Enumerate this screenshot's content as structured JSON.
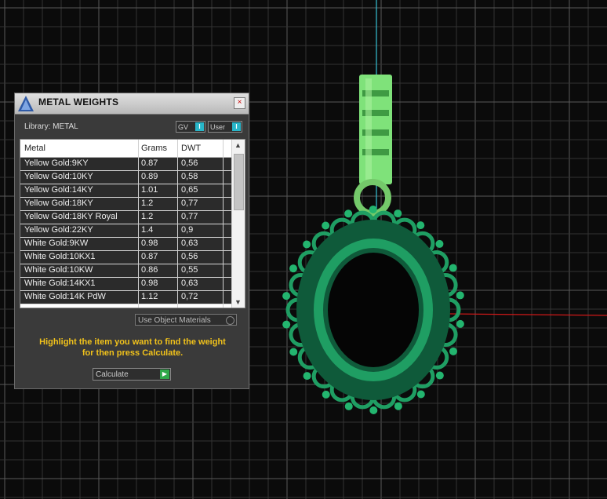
{
  "panel": {
    "title": "METAL WEIGHTS",
    "close_label": "×",
    "library_label": "Library: METAL",
    "toggle_gv": "GV",
    "toggle_user": "User",
    "toggle_indicator": "I",
    "columns": [
      "Metal",
      "Grams",
      "DWT"
    ],
    "rows": [
      {
        "metal": "Yellow Gold:9KY",
        "grams": "0.87",
        "dwt": "0,56"
      },
      {
        "metal": "Yellow Gold:10KY",
        "grams": "0.89",
        "dwt": "0,58"
      },
      {
        "metal": "Yellow Gold:14KY",
        "grams": "1.01",
        "dwt": "0,65"
      },
      {
        "metal": "Yellow Gold:18KY",
        "grams": "1.2",
        "dwt": "0,77"
      },
      {
        "metal": "Yellow Gold:18KY Royal",
        "grams": "1.2",
        "dwt": "0,77"
      },
      {
        "metal": "Yellow Gold:22KY",
        "grams": "1.4",
        "dwt": "0,9"
      },
      {
        "metal": "White Gold:9KW",
        "grams": "0.98",
        "dwt": "0,63"
      },
      {
        "metal": "White Gold:10KX1",
        "grams": "0.87",
        "dwt": "0,56"
      },
      {
        "metal": "White Gold:10KW",
        "grams": "0.86",
        "dwt": "0,55"
      },
      {
        "metal": "White Gold:14KX1",
        "grams": "0.98",
        "dwt": "0,63"
      },
      {
        "metal": "White Gold:14K PdW",
        "grams": "1.12",
        "dwt": "0,72"
      }
    ],
    "use_object_materials": "Use Object Materials",
    "instruction_line1": "Highlight the item you want to find the weight",
    "instruction_line2": "for then press Calculate.",
    "calculate_label": "Calculate",
    "calculate_arrow": "▶"
  },
  "colors": {
    "instruction": "#f1c21b",
    "axis_green": "#35c2d6",
    "axis_red": "#d01818",
    "model_green": "#1f9e63",
    "bail_green": "#7fe27a"
  }
}
